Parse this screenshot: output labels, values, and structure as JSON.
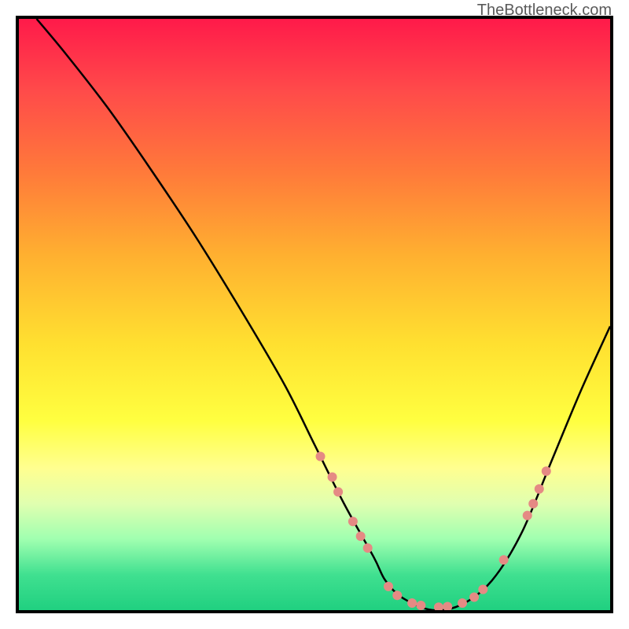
{
  "watermark": "TheBottleneck.com",
  "chart_data": {
    "type": "line",
    "title": "",
    "xlabel": "",
    "ylabel": "",
    "xlim": [
      0,
      100
    ],
    "ylim": [
      0,
      100
    ],
    "grid": false,
    "legend": false,
    "background": {
      "type": "vertical-gradient",
      "stops": [
        {
          "pos": 0,
          "color": "#ff1a4a"
        },
        {
          "pos": 55,
          "color": "#ffe030"
        },
        {
          "pos": 82,
          "color": "#e0ffb0"
        },
        {
          "pos": 100,
          "color": "#20d080"
        }
      ]
    },
    "series": [
      {
        "name": "bottleneck-curve",
        "color": "#000000",
        "x": [
          3,
          8,
          15,
          22,
          30,
          38,
          45,
          50,
          55,
          60,
          62,
          65,
          70,
          75,
          80,
          85,
          90,
          95,
          100
        ],
        "y": [
          100,
          94,
          85,
          75,
          63,
          50,
          38,
          28,
          18,
          9,
          5,
          2,
          0,
          1,
          5,
          13,
          25,
          37,
          48
        ]
      }
    ],
    "markers": {
      "name": "highlight-dots",
      "color": "#e58a84",
      "radius": 6,
      "points": [
        {
          "x": 51,
          "y": 26
        },
        {
          "x": 53,
          "y": 22.5
        },
        {
          "x": 54,
          "y": 20
        },
        {
          "x": 56.5,
          "y": 15
        },
        {
          "x": 57.8,
          "y": 12.5
        },
        {
          "x": 59,
          "y": 10.5
        },
        {
          "x": 62.5,
          "y": 4
        },
        {
          "x": 64,
          "y": 2.5
        },
        {
          "x": 66.5,
          "y": 1.2
        },
        {
          "x": 68,
          "y": 0.8
        },
        {
          "x": 71,
          "y": 0.5
        },
        {
          "x": 72.5,
          "y": 0.6
        },
        {
          "x": 75,
          "y": 1.2
        },
        {
          "x": 77,
          "y": 2.2
        },
        {
          "x": 78.5,
          "y": 3.5
        },
        {
          "x": 82,
          "y": 8.5
        },
        {
          "x": 86,
          "y": 16
        },
        {
          "x": 87,
          "y": 18
        },
        {
          "x": 88,
          "y": 20.5
        },
        {
          "x": 89.2,
          "y": 23.5
        }
      ]
    }
  }
}
